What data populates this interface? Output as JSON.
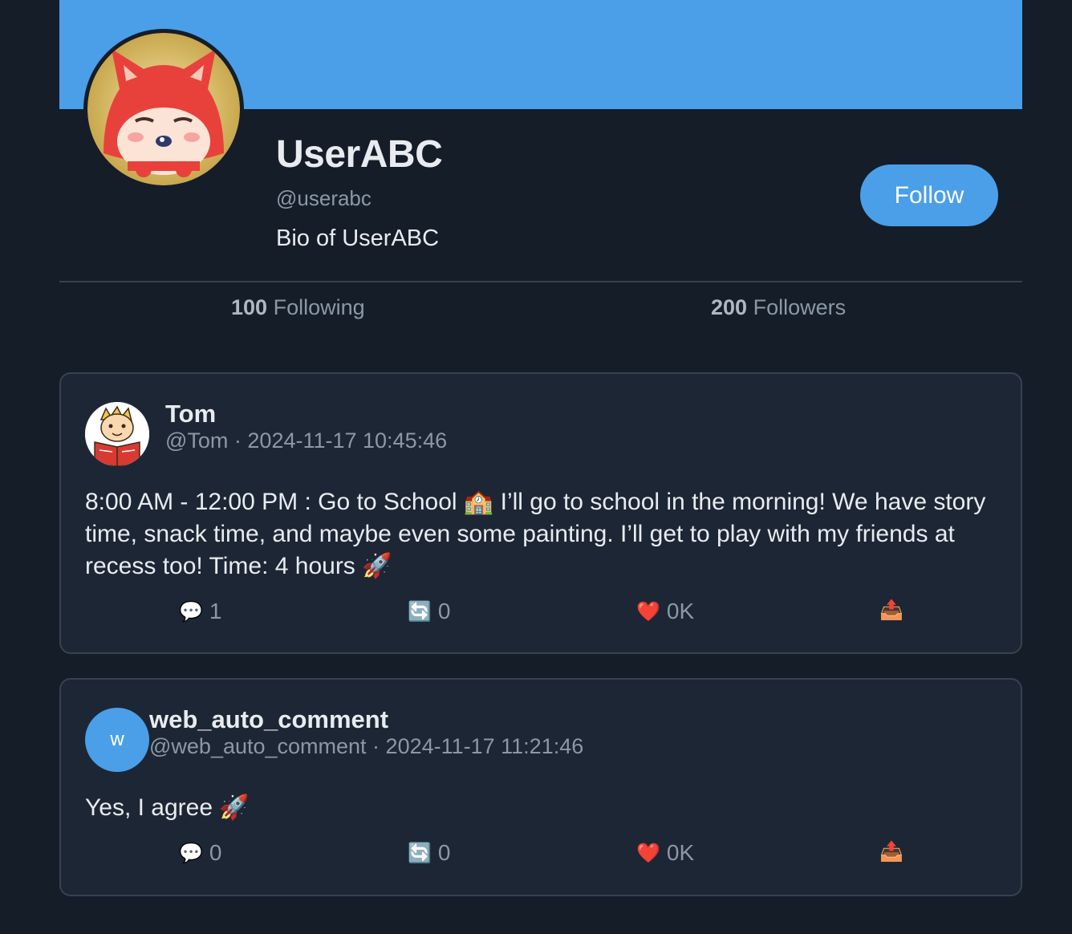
{
  "profile": {
    "display_name": "UserABC",
    "handle": "@userabc",
    "bio": "Bio of UserABC",
    "follow_label": "Follow",
    "following_count": "100",
    "following_label": "Following",
    "followers_count": "200",
    "followers_label": "Followers",
    "banner_color": "#4a9fe8"
  },
  "posts": [
    {
      "author": "Tom",
      "meta": "@Tom · 2024-11-17 10:45:46",
      "avatar_icon": "boy-reading-book",
      "text": "8:00 AM - 12:00 PM : Go to School 🏫 I’ll go to school in the morning! We have story time, snack time, and maybe even some painting. I’ll get to play with my friends at recess too! Time: 4 hours 🚀",
      "comments": "1",
      "reposts": "0",
      "likes": "0K"
    },
    {
      "author": "web_auto_comment",
      "meta": "@web_auto_comment · 2024-11-17 11:21:46",
      "avatar_letter": "w",
      "text": "Yes, I agree 🚀",
      "comments": "0",
      "reposts": "0",
      "likes": "0K"
    }
  ],
  "icons": {
    "comment": "💬",
    "repost": "🔄",
    "like": "❤️",
    "share": "📤"
  }
}
